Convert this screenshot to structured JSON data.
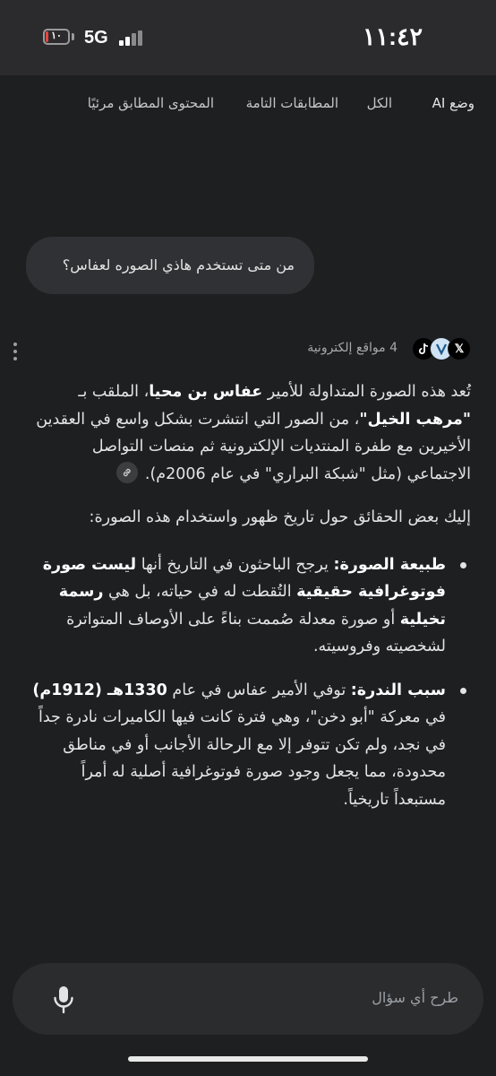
{
  "status_bar": {
    "time": "١١:٤٢",
    "battery_level": "١٠",
    "battery_fraction": 0.1,
    "network": "5G",
    "battery_color": "#e5453f"
  },
  "tabs": [
    {
      "label": "وضع AI",
      "active": true
    },
    {
      "label": "الكل",
      "active": false
    },
    {
      "label": "المطابقات التامة",
      "active": false
    },
    {
      "label": "المحتوى المطابق مرئيًا",
      "active": false
    }
  ],
  "user_query": "من متى تستخدم هاذي الصوره لعفاس؟",
  "sources": {
    "count_label": "4 مواقع إلكترونية",
    "icons": [
      "x-icon",
      "site-icon",
      "tiktok-icon"
    ]
  },
  "answer": {
    "p1": {
      "t1": "تُعد هذه الصورة المتداولة للأمير ",
      "b1": "عفاس بن محيا",
      "t2": "، الملقب بـ ",
      "b2": "\"مرهب الخيل\"",
      "t3": "، من الصور التي انتشرت بشكل واسع في العقدين الأخيرين مع طفرة المنتديات الإلكترونية ثم منصات التواصل الاجتماعي (مثل \"شبكة البراري\" في عام 2006م)."
    },
    "p2": "إليك بعض الحقائق حول تاريخ ظهور واستخدام هذه الصورة:",
    "bullet1": {
      "b1": "طبيعة الصورة:",
      "t1": " يرجح الباحثون في التاريخ أنها ",
      "b2": "ليست صورة فوتوغرافية حقيقية",
      "t2": " التُقطت له في حياته، بل هي ",
      "b3": "رسمة تخيلية",
      "t3": " أو صورة معدلة صُممت بناءً على الأوصاف المتواترة لشخصيته وفروسيته."
    },
    "bullet2": {
      "b1": "سبب الندرة:",
      "t1": " توفي الأمير عفاس في عام ",
      "b2": "1330هـ (1912م)",
      "t2": " في معركة \"أبو دخن\"، وهي فترة كانت فيها الكاميرات نادرة جداً في نجد، ولم تكن تتوفر إلا مع الرحالة الأجانب أو في مناطق محدودة، مما يجعل وجود صورة فوتوغرافية أصلية له أمراً مستبعداً تاريخياً."
    }
  },
  "input": {
    "placeholder": "طرح أي سؤال"
  },
  "colors": {
    "background": "#1e1f20",
    "status_bar": "#2b2b2d",
    "bubble": "#303134",
    "input": "#2b2c2e"
  }
}
